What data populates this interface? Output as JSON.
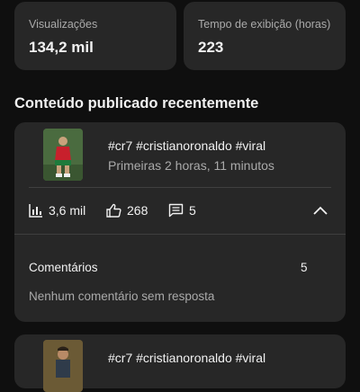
{
  "stats": [
    {
      "label": "Visualizações",
      "value": "134,2 mil"
    },
    {
      "label": "Tempo de exibição (horas)",
      "value": "223"
    }
  ],
  "section_title": "Conteúdo publicado recentemente",
  "videos": [
    {
      "title": "#cr7 #cristianoronaldo #viral",
      "subtitle": "Primeiras 2 horas, 11 minutos",
      "views": "3,6 mil",
      "likes": "268",
      "comments": "5",
      "icons": [
        "bar-chart-icon",
        "thumb-up-icon",
        "comment-icon",
        "chevron-up-icon"
      ],
      "comments_section": {
        "label": "Comentários",
        "count": "5",
        "empty_text": "Nenhum comentário sem resposta"
      }
    },
    {
      "title": "#cr7 #cristianoronaldo #viral"
    }
  ]
}
